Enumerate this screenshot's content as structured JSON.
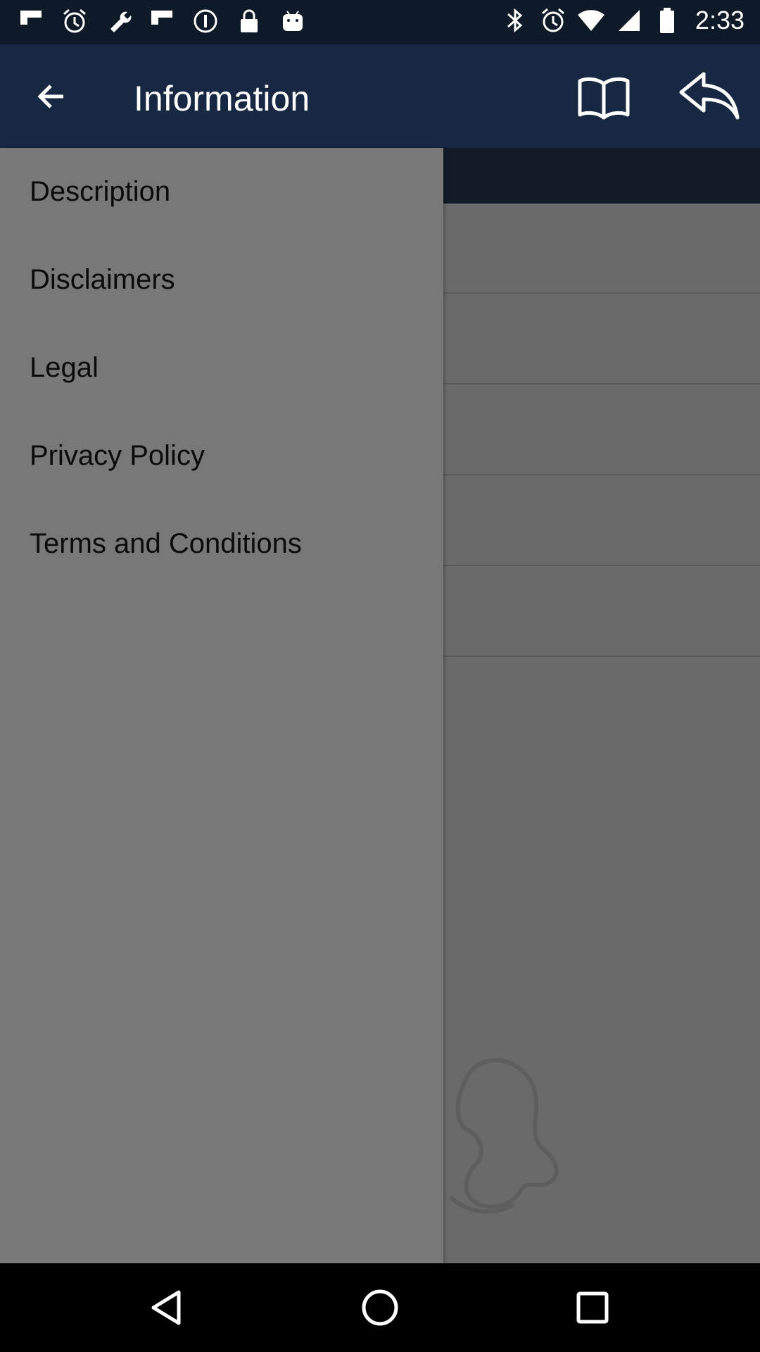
{
  "status_bar": {
    "time": "2:33",
    "left_icons": [
      "flipboard-icon",
      "alarm-icon",
      "wrench-icon",
      "flipboard-icon",
      "info-icon",
      "lock-icon",
      "android-icon"
    ],
    "right_icons": [
      "bluetooth-icon",
      "alarm-icon",
      "wifi-icon",
      "signal-icon",
      "battery-icon"
    ]
  },
  "app_bar": {
    "title": "Information",
    "back_icon": "arrow-left-icon",
    "actions": [
      "book-icon",
      "reply-icon"
    ]
  },
  "drawer": {
    "items": [
      {
        "label": "Description"
      },
      {
        "label": "Disclaimers"
      },
      {
        "label": "Legal"
      },
      {
        "label": "Privacy Policy"
      },
      {
        "label": "Terms and Conditions"
      }
    ]
  },
  "nav_bar": {
    "buttons": [
      "back-triangle-icon",
      "home-circle-icon",
      "recents-square-icon"
    ]
  },
  "colors": {
    "app_bar": "#182842",
    "status_bar": "#0f1a29",
    "drawer": "#787878",
    "scrim": "#6a6a6a"
  }
}
